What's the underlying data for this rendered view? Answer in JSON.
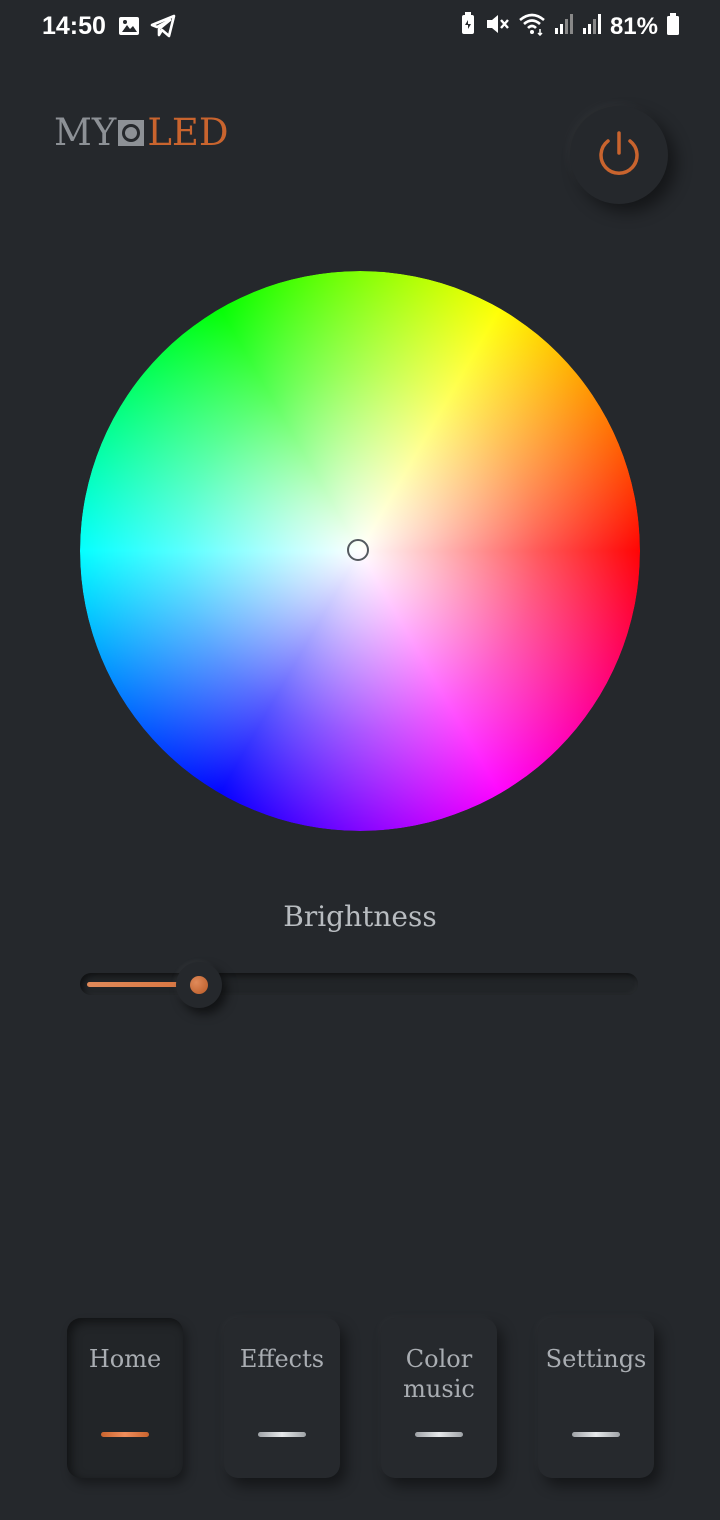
{
  "status_bar": {
    "time": "14:50",
    "left_icons": [
      "image-icon",
      "telegram-icon"
    ],
    "right_icons": [
      "battery-saver-icon",
      "mute-icon",
      "wifi-icon",
      "signal-1-icon",
      "signal-2-icon"
    ],
    "battery": "81%"
  },
  "header": {
    "logo_left": "MY",
    "logo_right": "LED",
    "power_icon": "power-icon"
  },
  "colors": {
    "accent": "#c9642e",
    "background": "#25282c",
    "logo_gray": "#8d9196"
  },
  "brightness": {
    "label": "Brightness",
    "value": 0.2
  },
  "nav": {
    "items": [
      {
        "label": "Home",
        "active": true
      },
      {
        "label": "Effects",
        "active": false
      },
      {
        "label": "Color music",
        "active": false
      },
      {
        "label": "Settings",
        "active": false
      }
    ]
  }
}
